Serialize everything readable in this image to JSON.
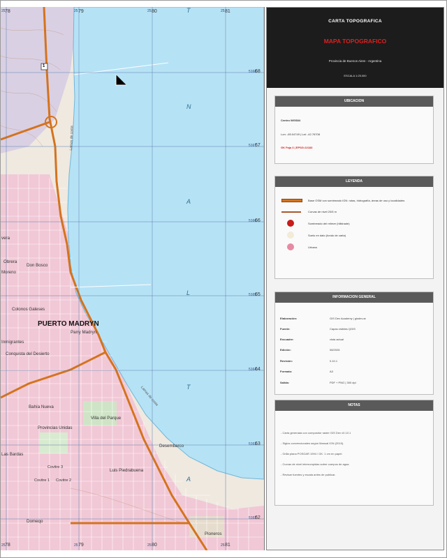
{
  "colors": {
    "sea": "#b6e2f5",
    "urban": "#f1c8d6",
    "grid_lines": "#5d7fb0",
    "roads_main": "#d5731d",
    "contour": "#a9572b",
    "panel_header": "#1c1c1c",
    "title_red": "#e01f1f"
  },
  "map": {
    "grid_top": [
      "78",
      "79",
      "80",
      "81"
    ],
    "grid_bottom": [
      "78",
      "79",
      "80",
      "81"
    ],
    "grid_right": [
      "68",
      "67",
      "66",
      "65",
      "64",
      "63",
      "62"
    ],
    "prefix_right": [
      "5168",
      "5167",
      "5166",
      "5165",
      "5164",
      "5163",
      "5162"
    ],
    "prefix_top": [
      "25",
      "25",
      "25",
      "25"
    ],
    "prefix_bottom": [
      "25",
      "25",
      "25",
      "25"
    ],
    "route_marker": "1",
    "city": "PUERTO MADRYN",
    "sea_letters": [
      "T",
      "N",
      "A",
      "L",
      "T",
      "A"
    ],
    "coast_labels": [
      "Lamas de costa",
      "Lamas de costa"
    ],
    "places": [
      "Obrera",
      "Don Bosco",
      "Moreno",
      "Colonos Galeses",
      "Parry Madryn",
      "Inmigrantes",
      "Conquista del Desierto",
      "Bahía Nueva",
      "Villa del Parque",
      "Provincias Unidas",
      "Las Bardas",
      "Covitre 3",
      "Covitre 1",
      "Covitre 2",
      "Desembarco",
      "Luis Piedrabuena",
      "Domeqo",
      "Pioneros",
      "vera"
    ]
  },
  "panel": {
    "title_header": "CARTA TOPOGRAFICA",
    "title_main": "MAPA TOPOGRAFICO",
    "title_sub": "Provincia de Buenos Aires - Argentina",
    "scale": "ESCALA 1:25.000",
    "location": {
      "header": "UBICACION",
      "center": "Centro WGS84",
      "coords": "Lon: -65.04749 | Lat: -42.76708",
      "crs": "GK Faja 3 | EPSG:22183"
    },
    "legend": {
      "header": "LEYENDA",
      "items": [
        {
          "label": "Base OSM con sombreado IGN: rutas, hidrografía, áreas de uso y localidades"
        },
        {
          "label": "Curvas de nivel 20/5 m"
        },
        {
          "label": "Sombreado del relieve (hillshade)"
        },
        {
          "label": "Suelo en dato (fondo de carta)"
        },
        {
          "label": "Urbano"
        }
      ]
    },
    "info": {
      "header": "INFORMACION GENERAL",
      "rows": [
        {
          "k": "Elaboración:",
          "v": "GIS Dev Academy | gisdev.ar"
        },
        {
          "k": "Fuente:",
          "v": "Capas visibles QGIS"
        },
        {
          "k": "Encuadre:",
          "v": "vista actual"
        },
        {
          "k": "Edición:",
          "v": "08/2026"
        },
        {
          "k": "Revisión:",
          "v": "0.10.1"
        },
        {
          "k": "Formato:",
          "v": "A3"
        },
        {
          "k": "Salida:",
          "v": "PDF + PNG | 300 dpi"
        }
      ]
    },
    "notes": {
      "header": "NOTAS",
      "items": [
        "- Carta generada con compositor raster GIS Dev v0.10.1",
        "- Siglos convencionales según Manual IGN (2015).",
        "- Grilla plana POSGAR 1994 / GK. 1 cm en papel.",
        "- Curvas de nivel interrumpidas sobre cuerpos de agua.",
        "- Revisar fuentes y escala antes de publicar."
      ]
    }
  }
}
